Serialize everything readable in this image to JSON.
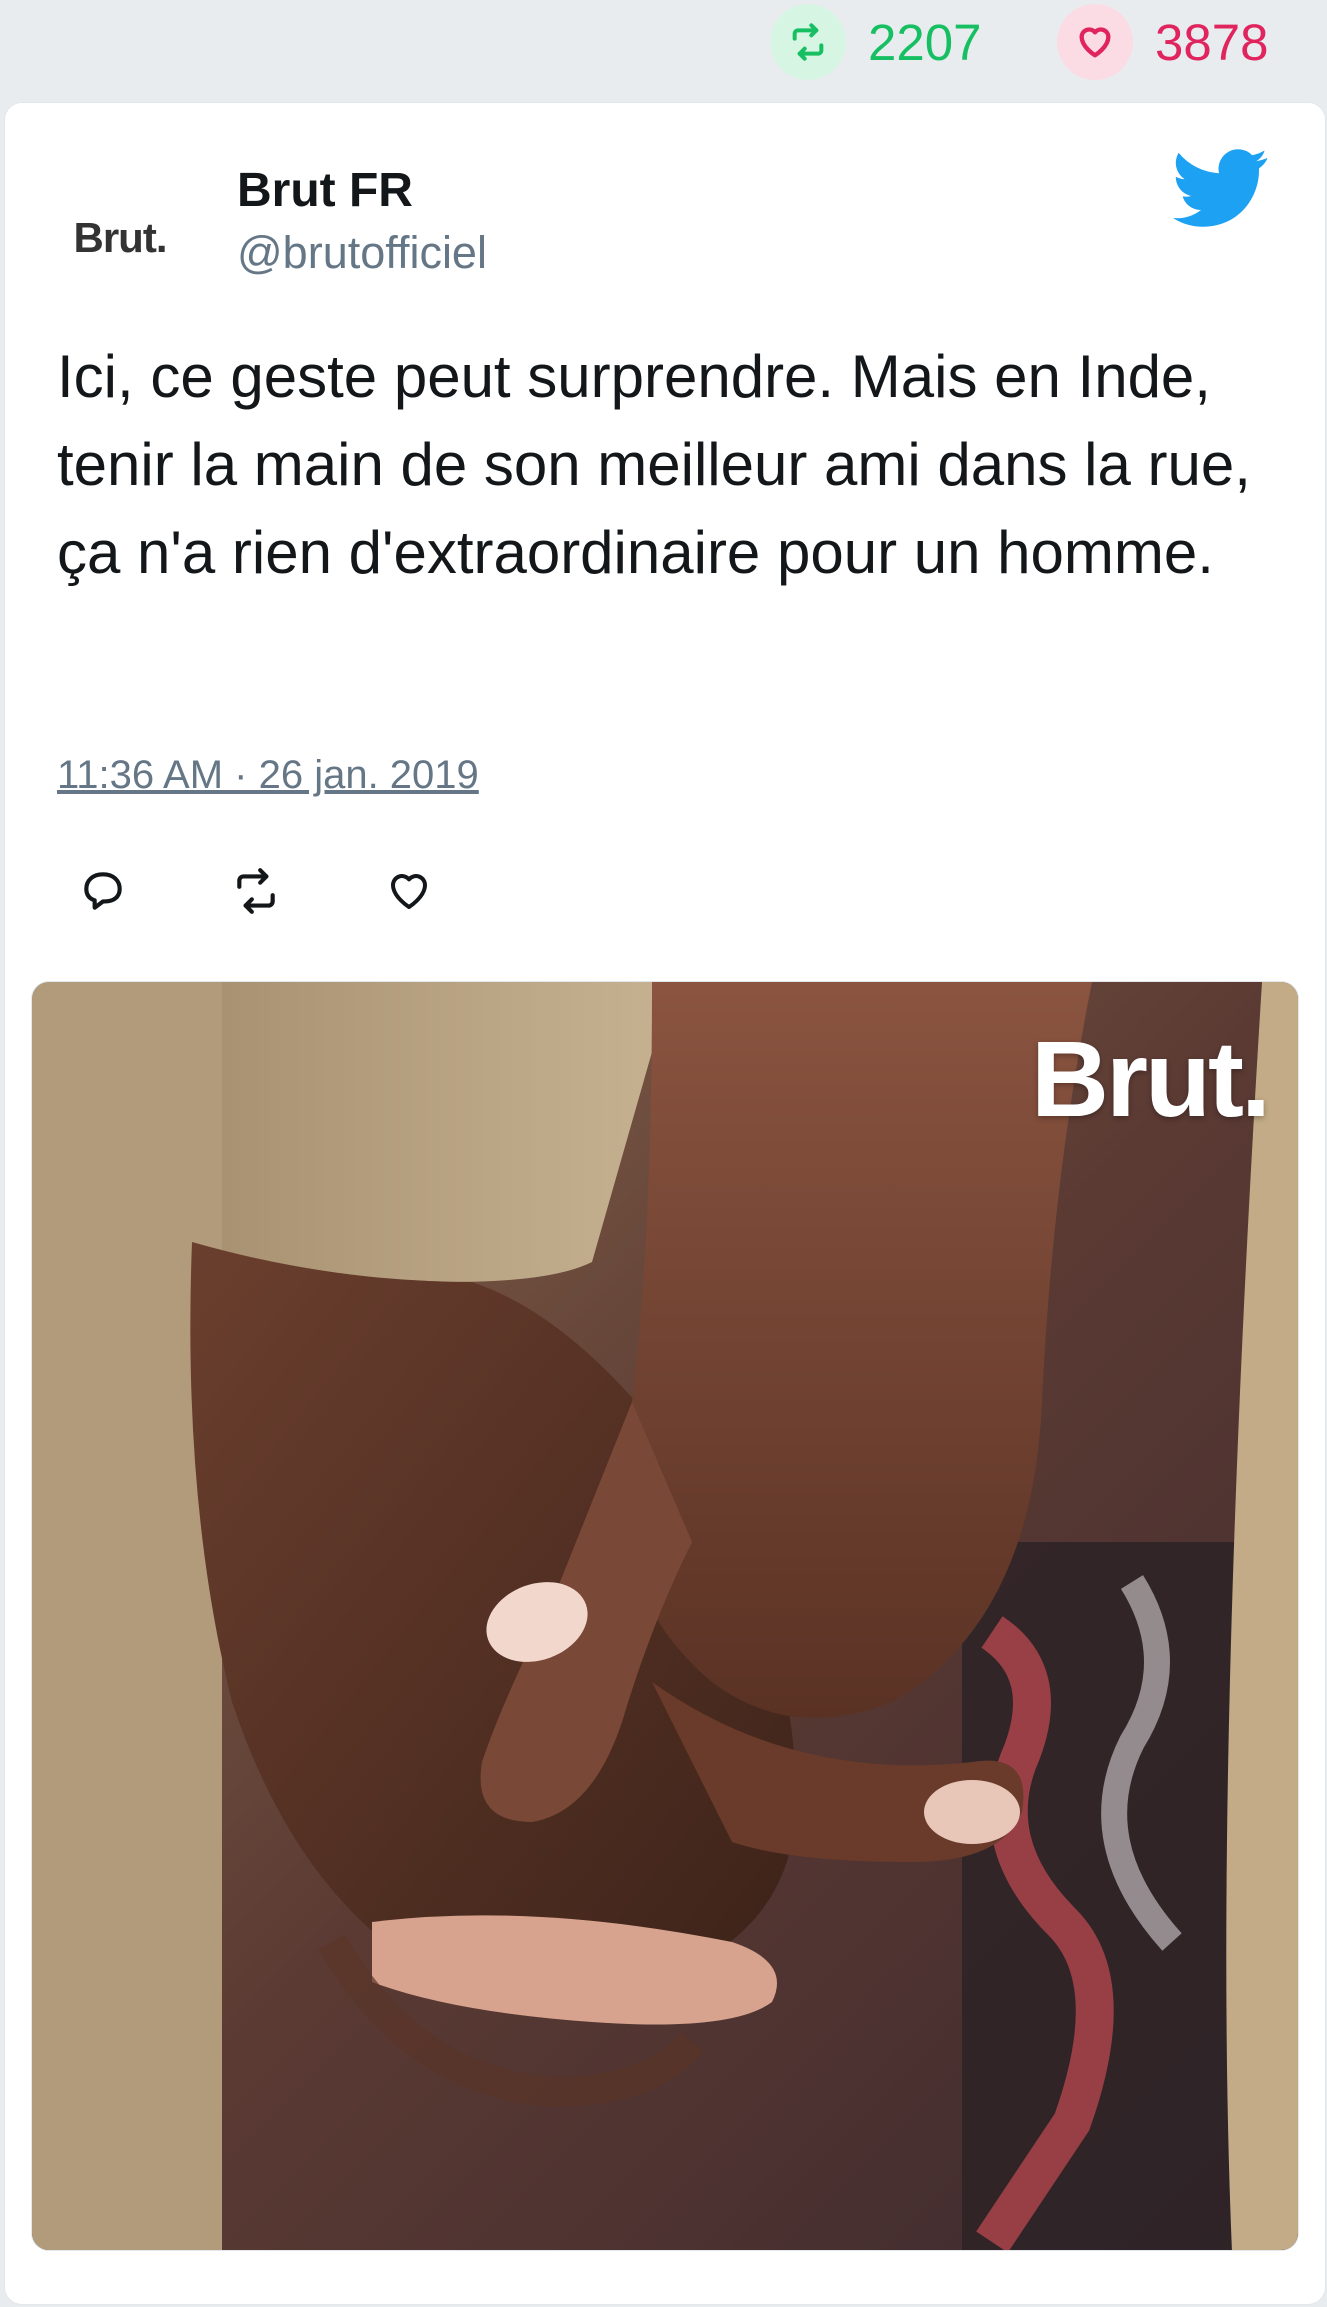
{
  "stats": {
    "retweets": "2207",
    "likes": "3878",
    "retweet_icon": "retweet-icon",
    "like_icon": "heart-icon",
    "retweet_color": "#17bf63",
    "like_color": "#e0245e"
  },
  "tweet": {
    "avatar_text": "Brut.",
    "display_name": "Brut FR",
    "handle": "@brutofficiel",
    "text": "Ici, ce geste peut surprendre. Mais en Inde, tenir la main de son meilleur ami dans la rue, ça n'a rien d'extraordinaire pour un homme.",
    "timestamp": "11:36 AM · 26 jan. 2019",
    "brand_icon": "twitter-bird-icon",
    "brand_color": "#1da1f2"
  },
  "actions": [
    {
      "icon": "reply-icon"
    },
    {
      "icon": "retweet-icon"
    },
    {
      "icon": "like-icon"
    }
  ],
  "media": {
    "description_icon": "photo-two-men-holding-hands",
    "watermark": "Brut."
  }
}
